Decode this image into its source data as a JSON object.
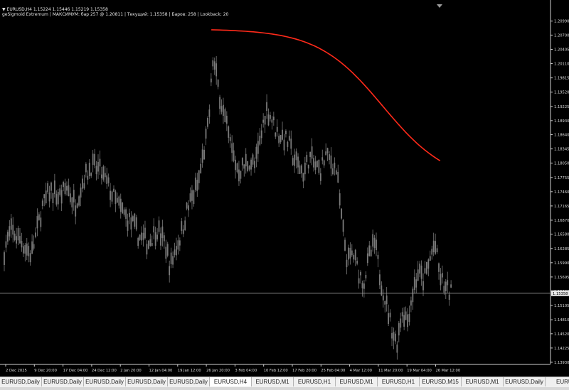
{
  "header": {
    "symbol_line": "▼ EURUSD,H4  1.15224 1.15446 1.15219 1.15358",
    "indicator_line": "geSigmoid Extremum | МАКСИМУМ: бар 257 @ 1.20811 | Текущий: 1.15358 | Баров: 258 | Lookback: 20"
  },
  "chart_data": {
    "type": "candlestick",
    "symbol": "EURUSD",
    "timeframe": "H4",
    "current_price": 1.15358,
    "current_price_label": "1.15358",
    "extremum": {
      "type": "max",
      "bar": 257,
      "price": 1.20811
    },
    "ylim": [
      1.139,
      1.2125
    ],
    "yticks": [
      "1.20990",
      "1.20700",
      "1.20405",
      "1.20110",
      "1.19815",
      "1.19520",
      "1.19225",
      "1.18930",
      "1.18640",
      "1.18345",
      "1.18050",
      "1.17755",
      "1.17460",
      "1.17165",
      "1.16870",
      "1.16580",
      "1.16285",
      "1.15990",
      "1.15695",
      "1.15400",
      "1.15105",
      "1.14810",
      "1.14520",
      "1.14225",
      "1.13930"
    ],
    "xticks": [
      "2 Dec 2025",
      "9 Dec 20:00",
      "17 Dec 04:00",
      "24 Dec 12:00",
      "2 Jan 20:00",
      "12 Jan 04:00",
      "19 Jan 12:00",
      "26 Jan 20:00",
      "3 Feb 04:00",
      "10 Feb 12:00",
      "17 Feb 20:00",
      "25 Feb 04:00",
      "4 Mar 12:00",
      "11 Mar 20:00",
      "19 Mar 04:00",
      "26 Mar 12:00"
    ],
    "price_path": [
      [
        0,
        1.1625
      ],
      [
        0.012,
        1.1665
      ],
      [
        0.03,
        1.1645
      ],
      [
        0.05,
        1.1615
      ],
      [
        0.07,
        1.1715
      ],
      [
        0.085,
        1.175
      ],
      [
        0.1,
        1.1735
      ],
      [
        0.115,
        1.1755
      ],
      [
        0.13,
        1.172
      ],
      [
        0.145,
        1.177
      ],
      [
        0.16,
        1.18
      ],
      [
        0.175,
        1.179
      ],
      [
        0.19,
        1.176
      ],
      [
        0.205,
        1.1725
      ],
      [
        0.22,
        1.17
      ],
      [
        0.235,
        1.168
      ],
      [
        0.25,
        1.165
      ],
      [
        0.265,
        1.164
      ],
      [
        0.28,
        1.167
      ],
      [
        0.295,
        1.164
      ],
      [
        0.305,
        1.159
      ],
      [
        0.315,
        1.163
      ],
      [
        0.325,
        1.166
      ],
      [
        0.335,
        1.1705
      ],
      [
        0.345,
        1.1735
      ],
      [
        0.355,
        1.176
      ],
      [
        0.365,
        1.182
      ],
      [
        0.375,
        1.1885
      ],
      [
        0.383,
        1.202
      ],
      [
        0.39,
        1.198
      ],
      [
        0.4,
        1.192
      ],
      [
        0.41,
        1.187
      ],
      [
        0.42,
        1.182
      ],
      [
        0.43,
        1.179
      ],
      [
        0.44,
        1.18
      ],
      [
        0.45,
        1.181
      ],
      [
        0.46,
        1.18
      ],
      [
        0.47,
        1.185
      ],
      [
        0.48,
        1.192
      ],
      [
        0.49,
        1.19
      ],
      [
        0.5,
        1.187
      ],
      [
        0.51,
        1.186
      ],
      [
        0.52,
        1.185
      ],
      [
        0.53,
        1.182
      ],
      [
        0.54,
        1.18
      ],
      [
        0.55,
        1.1785
      ],
      [
        0.56,
        1.182
      ],
      [
        0.57,
        1.18
      ],
      [
        0.58,
        1.179
      ],
      [
        0.59,
        1.182
      ],
      [
        0.6,
        1.181
      ],
      [
        0.61,
        1.179
      ],
      [
        0.62,
        1.168
      ],
      [
        0.63,
        1.16
      ],
      [
        0.64,
        1.162
      ],
      [
        0.65,
        1.158
      ],
      [
        0.66,
        1.156
      ],
      [
        0.67,
        1.161
      ],
      [
        0.68,
        1.164
      ],
      [
        0.69,
        1.157
      ],
      [
        0.7,
        1.152
      ],
      [
        0.71,
        1.147
      ],
      [
        0.72,
        1.143
      ],
      [
        0.73,
        1.15
      ],
      [
        0.74,
        1.148
      ],
      [
        0.75,
        1.154
      ],
      [
        0.76,
        1.158
      ],
      [
        0.77,
        1.156
      ],
      [
        0.78,
        1.16
      ],
      [
        0.79,
        1.164
      ],
      [
        0.8,
        1.157
      ],
      [
        0.81,
        1.1545
      ],
      [
        0.82,
        1.1536
      ]
    ],
    "sigmoid_line": {
      "color": "#ff2a1a",
      "start": [
        0.38,
        1.2081
      ],
      "end": [
        0.8,
        1.181
      ]
    },
    "colors": {
      "candle": "#7a7a7a",
      "grid": "#2a2a2a",
      "axis": "#d0d0d0",
      "price_line": "#9a9a9a",
      "label_bg": "#e8e8e8"
    }
  },
  "tabs": [
    {
      "label": "EURUSD,Daily",
      "active": false
    },
    {
      "label": "EURUSD,Daily",
      "active": false
    },
    {
      "label": "EURUSD,Daily",
      "active": false
    },
    {
      "label": "EURUSD,Daily",
      "active": false
    },
    {
      "label": "EURUSD,Daily",
      "active": false
    },
    {
      "label": "EURUSD,H4",
      "active": true
    },
    {
      "label": "EURUSD,M1",
      "active": false
    },
    {
      "label": "EURUSD,H1",
      "active": false
    },
    {
      "label": "EURUSD,M1",
      "active": false
    },
    {
      "label": "EURUSD,H1",
      "active": false
    },
    {
      "label": "EURUSD,M15",
      "active": false
    },
    {
      "label": "EURUSD,M1",
      "active": false
    },
    {
      "label": "EURUSD,Daily",
      "active": false
    },
    {
      "label": "EURUS",
      "active": false
    }
  ],
  "tab_scroll_icon": "scroll-right-icon"
}
